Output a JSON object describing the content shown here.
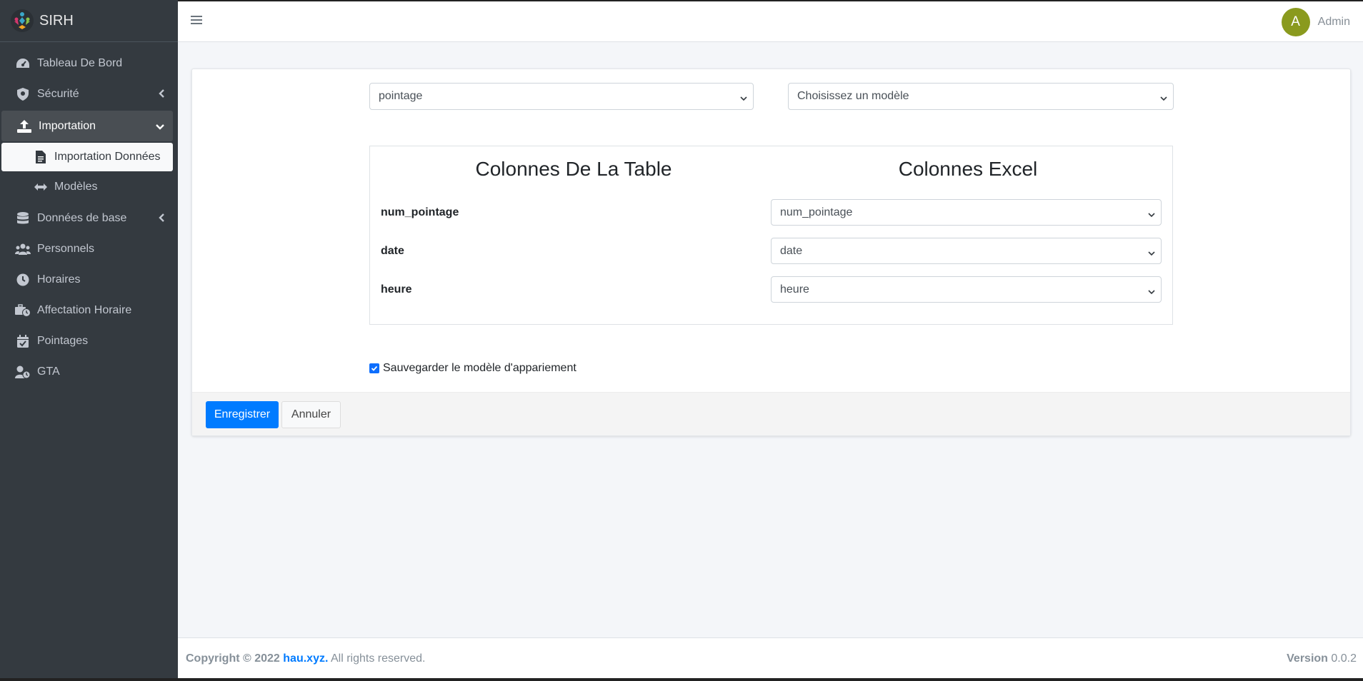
{
  "brand": {
    "name": "SIRH"
  },
  "sidebar": {
    "items": [
      {
        "label": "Tableau De Bord",
        "icon": "dashboard-icon"
      },
      {
        "label": "Sécurité",
        "icon": "shield-icon"
      },
      {
        "label": "Importation",
        "icon": "upload-icon"
      },
      {
        "label": "Données de base",
        "icon": "database-icon"
      },
      {
        "label": "Personnels",
        "icon": "users-icon"
      },
      {
        "label": "Horaires",
        "icon": "clock-icon"
      },
      {
        "label": "Affectation Horaire",
        "icon": "business-time-icon"
      },
      {
        "label": "Pointages",
        "icon": "calendar-check-icon"
      },
      {
        "label": "GTA",
        "icon": "user-clock-icon"
      }
    ],
    "sub_items": [
      {
        "label": "Importation Données",
        "icon": "file-icon"
      },
      {
        "label": "Modèles",
        "icon": "arrows-h-icon"
      }
    ]
  },
  "header": {
    "user_initial": "A",
    "user_name": "Admin"
  },
  "form": {
    "table_select": "pointage",
    "model_select": "Choisissez un modèle",
    "col_table_header": "Colonnes De La Table",
    "col_excel_header": "Colonnes Excel",
    "rows": [
      {
        "label": "num_pointage",
        "value": "num_pointage"
      },
      {
        "label": "date",
        "value": "date"
      },
      {
        "label": "heure",
        "value": "heure"
      }
    ],
    "save_model_label": "Sauvegarder le modèle d'appariement",
    "save_model_checked": true,
    "submit_label": "Enregistrer",
    "cancel_label": "Annuler"
  },
  "footer": {
    "copyright": "Copyright © 2022",
    "site": "hau.xyz.",
    "rights": "All rights reserved.",
    "version_label": "Version",
    "version_value": "0.0.2"
  },
  "colors": {
    "primary": "#007bff",
    "sidebar": "#343a40",
    "avatar": "#8a9a1e"
  }
}
